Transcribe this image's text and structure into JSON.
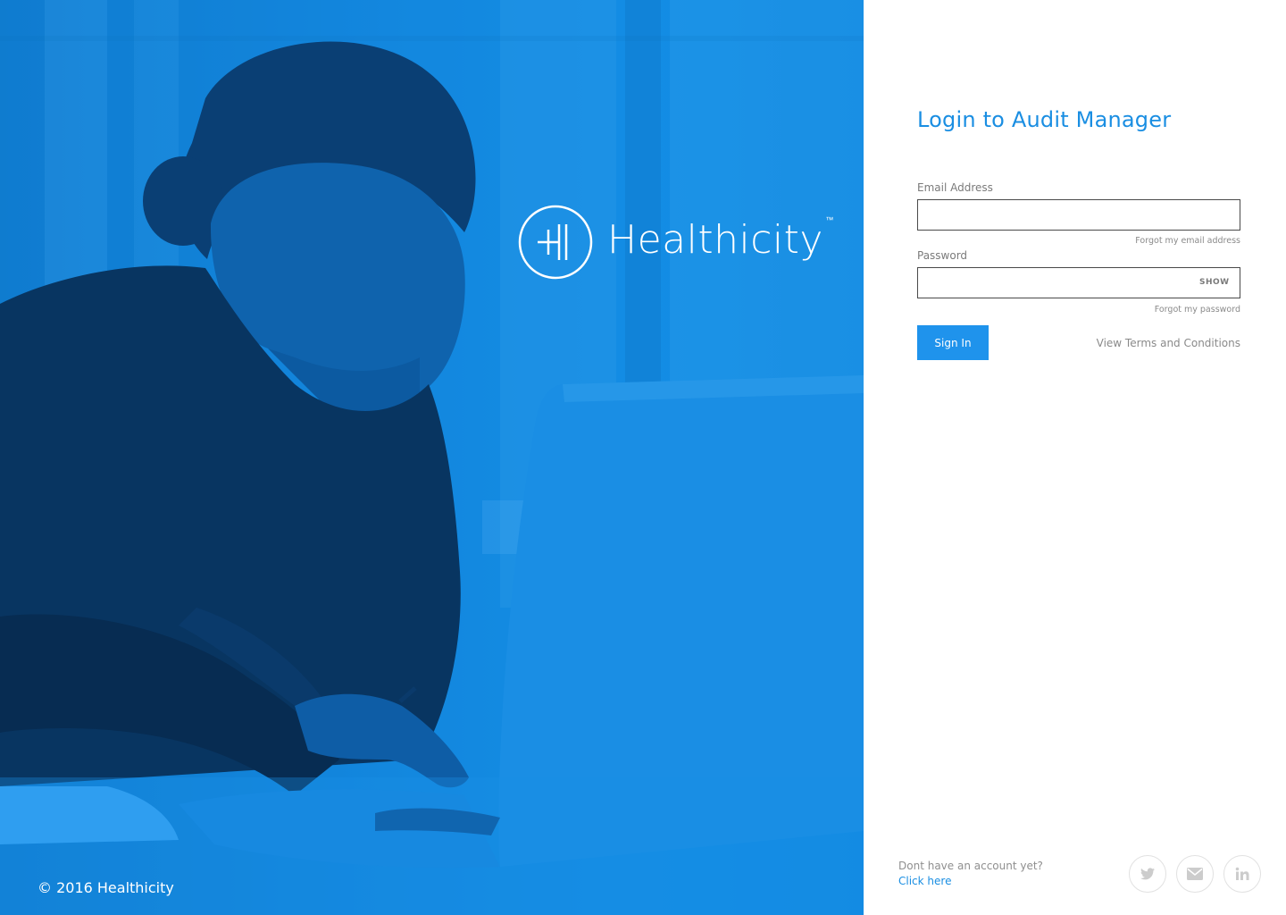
{
  "hero": {
    "brand_name": "Healthicity",
    "brand_tm": "™",
    "copyright": "© 2016 Healthicity"
  },
  "login": {
    "title": "Login to Audit Manager",
    "email": {
      "label": "Email Address",
      "value": "",
      "placeholder": "",
      "help_link": "Forgot my email address"
    },
    "password": {
      "label": "Password",
      "value": "",
      "placeholder": "",
      "toggle": "SHOW",
      "help_link": "Forgot my password"
    },
    "submit_label": "Sign In",
    "terms_link": "View Terms and Conditions"
  },
  "footer": {
    "prompt": "Dont have an account yet?",
    "signup_link": "Click here",
    "social": [
      "twitter-icon",
      "mail-icon",
      "linkedin-icon"
    ]
  },
  "colors": {
    "accent": "#1a8ee2",
    "button": "#1f93ec",
    "hero_blue": "#1587dd"
  }
}
